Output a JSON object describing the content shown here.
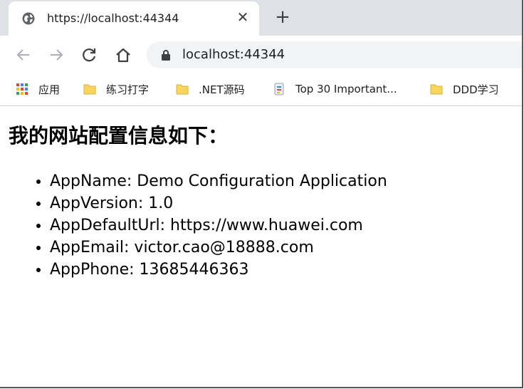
{
  "tab": {
    "title": "https://localhost:44344",
    "close_glyph": "✕",
    "favicon": "globe-icon"
  },
  "toolbar": {
    "new_tab_glyph": "+",
    "url": "localhost:44344"
  },
  "bookmarks": [
    {
      "label": "应用",
      "icon": "apps-grid-icon"
    },
    {
      "label": "练习打字",
      "icon": "folder-icon"
    },
    {
      "label": ".NET源码",
      "icon": "folder-icon"
    },
    {
      "label": "Top 30 Important...",
      "icon": "page-icon"
    },
    {
      "label": "DDD学习",
      "icon": "folder-icon"
    }
  ],
  "page": {
    "heading": "我的网站配置信息如下：",
    "items": [
      "AppName: Demo Configuration Application",
      "AppVersion: 1.0",
      "AppDefaultUrl: https://www.huawei.com",
      "AppEmail: victor.cao@18888.com",
      "AppPhone: 13685446363"
    ]
  },
  "colors": {
    "tabstrip": "#dee1e6",
    "omnibox": "#f1f3f4",
    "folder": "#f9d55b",
    "icon_gray": "#5f6368"
  }
}
